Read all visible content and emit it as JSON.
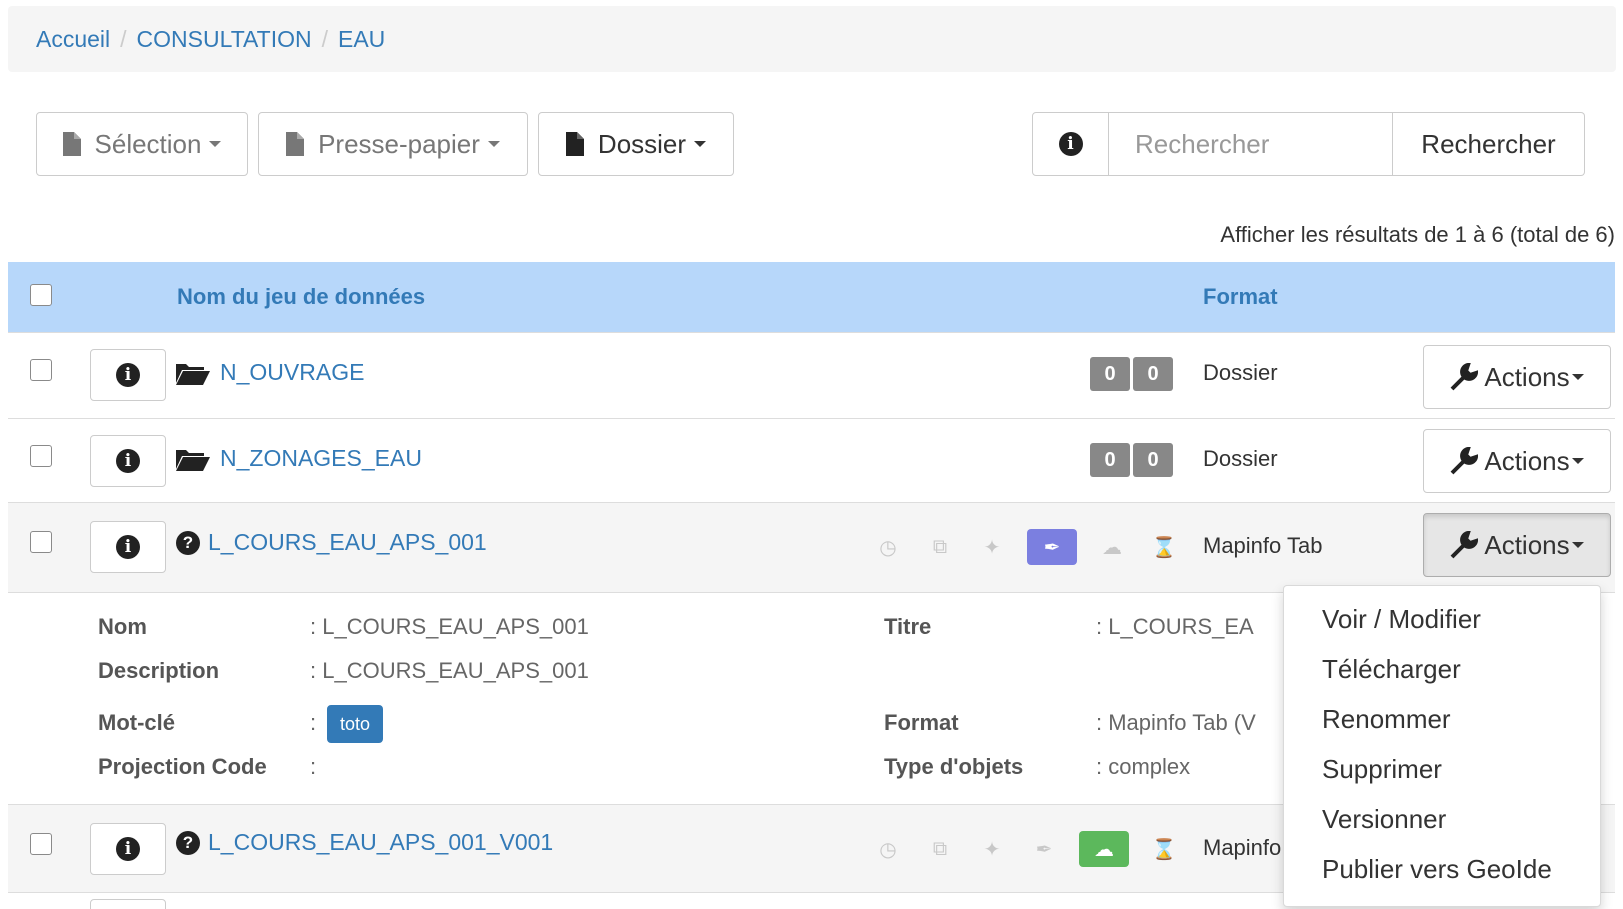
{
  "breadcrumb": {
    "items": [
      "Accueil",
      "CONSULTATION",
      "EAU"
    ],
    "separator": "/"
  },
  "toolbar": {
    "selection_label": "Sélection",
    "clipboard_label": "Presse-papier",
    "folder_label": "Dossier"
  },
  "search": {
    "placeholder": "Rechercher",
    "button_label": "Rechercher"
  },
  "results_info": "Afficher les résultats de 1 à 6 (total de 6)",
  "table": {
    "headers": {
      "name": "Nom du jeu de données",
      "format": "Format"
    },
    "rows": [
      {
        "name": "N_OUVRAGE",
        "type": "folder",
        "badges": [
          "0",
          "0"
        ],
        "format": "Dossier",
        "actions_label": "Actions"
      },
      {
        "name": "N_ZONAGES_EAU",
        "type": "folder",
        "badges": [
          "0",
          "0"
        ],
        "format": "Dossier",
        "actions_label": "Actions"
      },
      {
        "name": "L_COURS_EAU_APS_001",
        "type": "dataset",
        "format": "Mapinfo Tab",
        "actions_label": "Actions",
        "highlighted_status": "feather-icon"
      },
      {
        "name": "L_COURS_EAU_APS_001_V001",
        "type": "dataset",
        "format": "Mapinfo",
        "highlighted_status": "cloud-upload-icon"
      }
    ]
  },
  "details": {
    "labels": {
      "nom": "Nom",
      "description": "Description",
      "mot_cle": "Mot-clé",
      "projection": "Projection Code",
      "titre": "Titre",
      "format": "Format",
      "type_objets": "Type d'objets"
    },
    "values": {
      "nom": ": L_COURS_EAU_APS_001",
      "description": ": L_COURS_EAU_APS_001",
      "mot_cle_colon": ":",
      "tag": "toto",
      "projection": ":",
      "titre": ": L_COURS_EA",
      "format": ": Mapinfo Tab (V",
      "type_objets": ": complex"
    }
  },
  "dropdown": {
    "items": [
      "Voir / Modifier",
      "Télécharger",
      "Renommer",
      "Supprimer",
      "Versionner",
      "Publier vers GeoIde"
    ]
  },
  "colors": {
    "link": "#337ab7",
    "header_bg": "#b7d7fa",
    "badge_gray": "#888888",
    "status_purple": "#7b7fe0",
    "status_green": "#5cb85c"
  }
}
